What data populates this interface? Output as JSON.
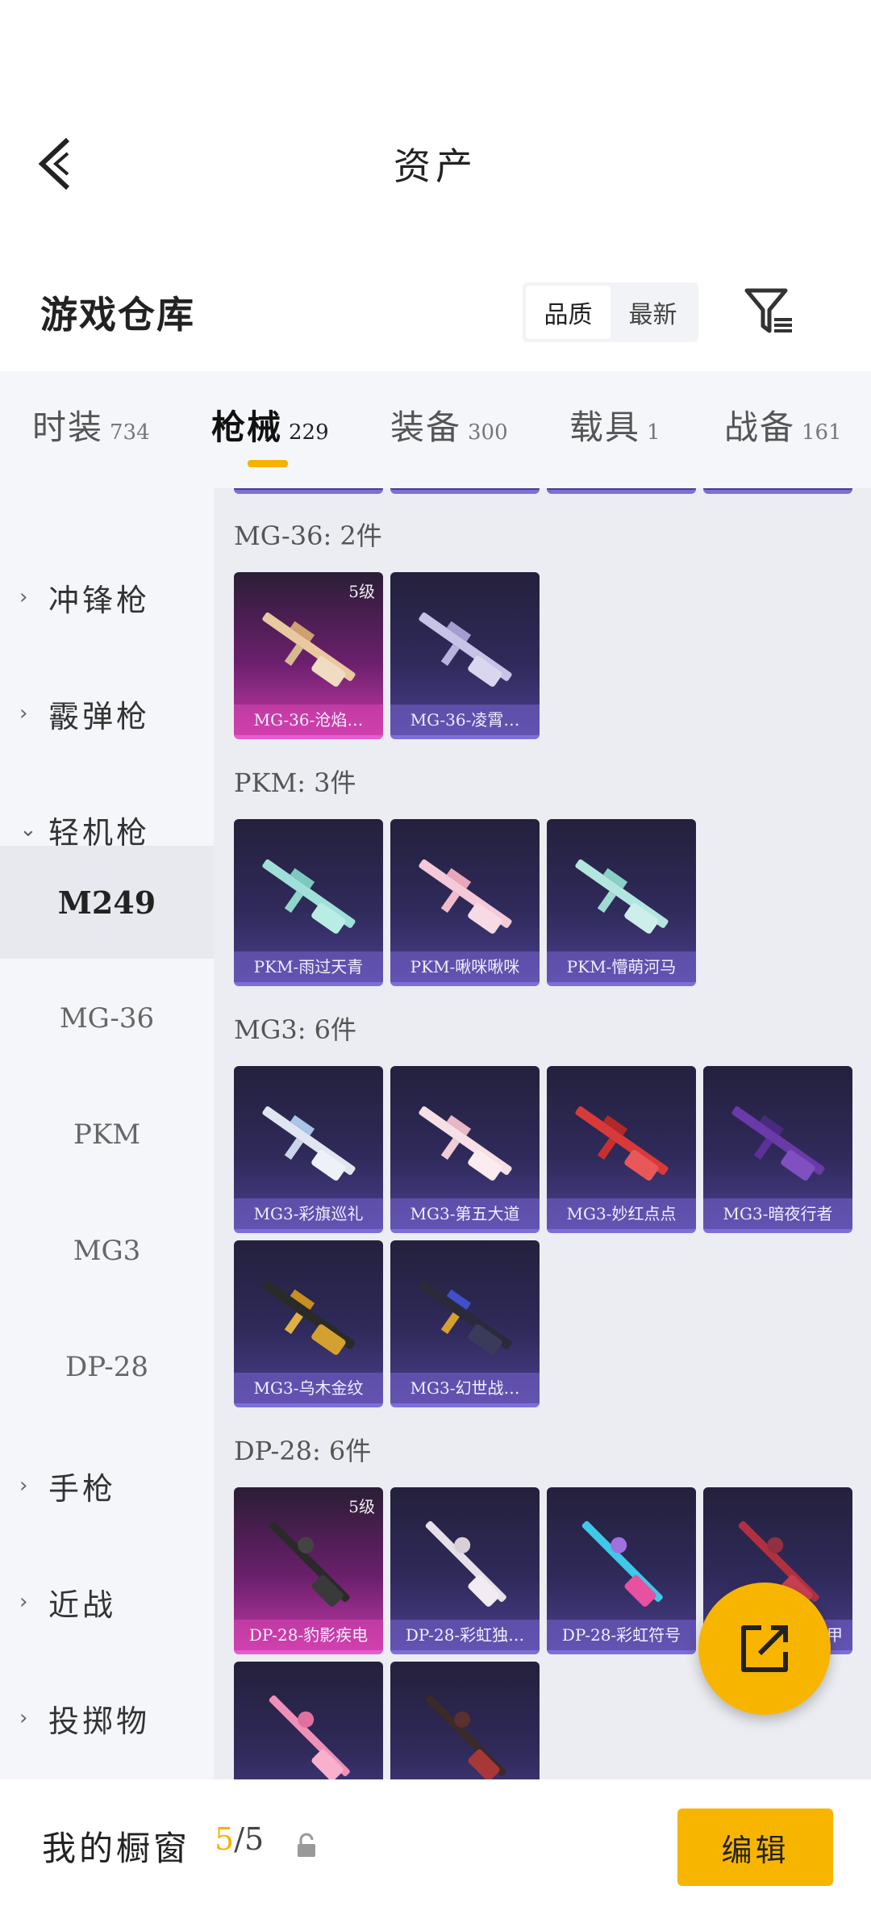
{
  "header": {
    "title": "资产"
  },
  "warehouse": {
    "title": "游戏仓库",
    "sort_options": [
      "品质",
      "最新"
    ],
    "active_sort": 0
  },
  "categories": [
    {
      "name": "时装",
      "count": "734"
    },
    {
      "name": "枪械",
      "count": "229"
    },
    {
      "name": "装备",
      "count": "300"
    },
    {
      "name": "载具",
      "count": "1"
    },
    {
      "name": "战备",
      "count": "161"
    }
  ],
  "sidebar": {
    "items": [
      "冲锋枪",
      "霰弹枪",
      "轻机枪",
      "手枪",
      "近战",
      "投掷物"
    ],
    "subitems": [
      "M249",
      "MG-36",
      "PKM",
      "MG3",
      "DP-28"
    ]
  },
  "groups": [
    {
      "title": "MG-36: 2件",
      "items": [
        {
          "name": "MG-36-沧焰…",
          "level": "5级"
        },
        {
          "name": "MG-36-凌霄…"
        }
      ]
    },
    {
      "title": "PKM: 3件",
      "items": [
        {
          "name": "PKM-雨过天青"
        },
        {
          "name": "PKM-啾咪啾咪"
        },
        {
          "name": "PKM-懵萌河马"
        }
      ]
    },
    {
      "title": "MG3: 6件",
      "items": [
        {
          "name": "MG3-彩旗巡礼"
        },
        {
          "name": "MG3-第五大道"
        },
        {
          "name": "MG3-妙红点点"
        },
        {
          "name": "MG3-暗夜行者"
        },
        {
          "name": "MG3-乌木金纹"
        },
        {
          "name": "MG3-幻世战…"
        }
      ]
    },
    {
      "title": "DP-28: 6件",
      "items": [
        {
          "name": "DP-28-豹影疾电",
          "level": "5级"
        },
        {
          "name": "DP-28-彩虹独…"
        },
        {
          "name": "DP-28-彩虹符号"
        },
        {
          "name": "甲"
        }
      ]
    }
  ],
  "bottom": {
    "label": "我的橱窗",
    "count_current": "5",
    "count_total": "/5",
    "edit": "编辑"
  }
}
